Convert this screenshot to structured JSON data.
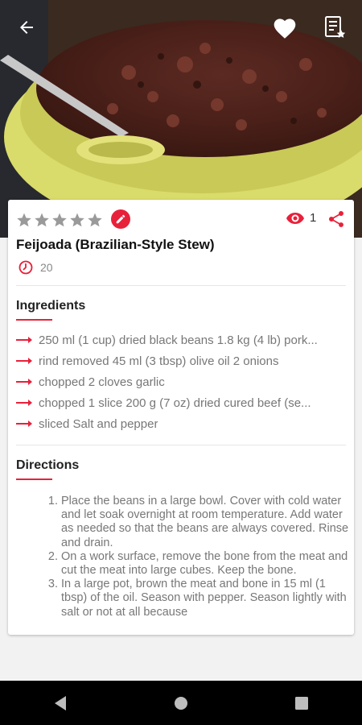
{
  "header": {
    "back_icon": "arrow-back-icon",
    "favorite_icon": "heart-icon",
    "shopping_list_icon": "list-star-icon"
  },
  "recipe": {
    "rating": 0,
    "rating_max": 5,
    "views": "1",
    "title": "Feijoada (Brazilian-Style Stew)",
    "time": "20",
    "accent": "#e8213a"
  },
  "ingredients": {
    "heading": "Ingredients",
    "items": [
      "250 ml (1 cup) dried black beans  1.8 kg (4 lb) pork...",
      "rind removed    45 ml (3 tbsp) olive oil  2 onions",
      "chopped    2 cloves garlic",
      "chopped    1 slice 200 g (7 oz) dried cured beef (se...",
      "sliced    Salt and pepper"
    ]
  },
  "directions": {
    "heading": "Directions",
    "steps": [
      "Place the beans in a large bowl. Cover with cold water and let soak overnight at room temperature. Add water as needed so that the beans are always covered. Rinse and drain.",
      "On a work surface, remove the bone from the meat and cut the meat into large cubes. Keep the bone.",
      "In a large pot, brown the meat and bone in 15 ml (1 tbsp) of the oil. Season with pepper. Season lightly with salt or not at all because"
    ]
  },
  "system_nav": {
    "back_icon": "nav-back-icon",
    "home_icon": "nav-home-icon",
    "recents_icon": "nav-recents-icon"
  }
}
